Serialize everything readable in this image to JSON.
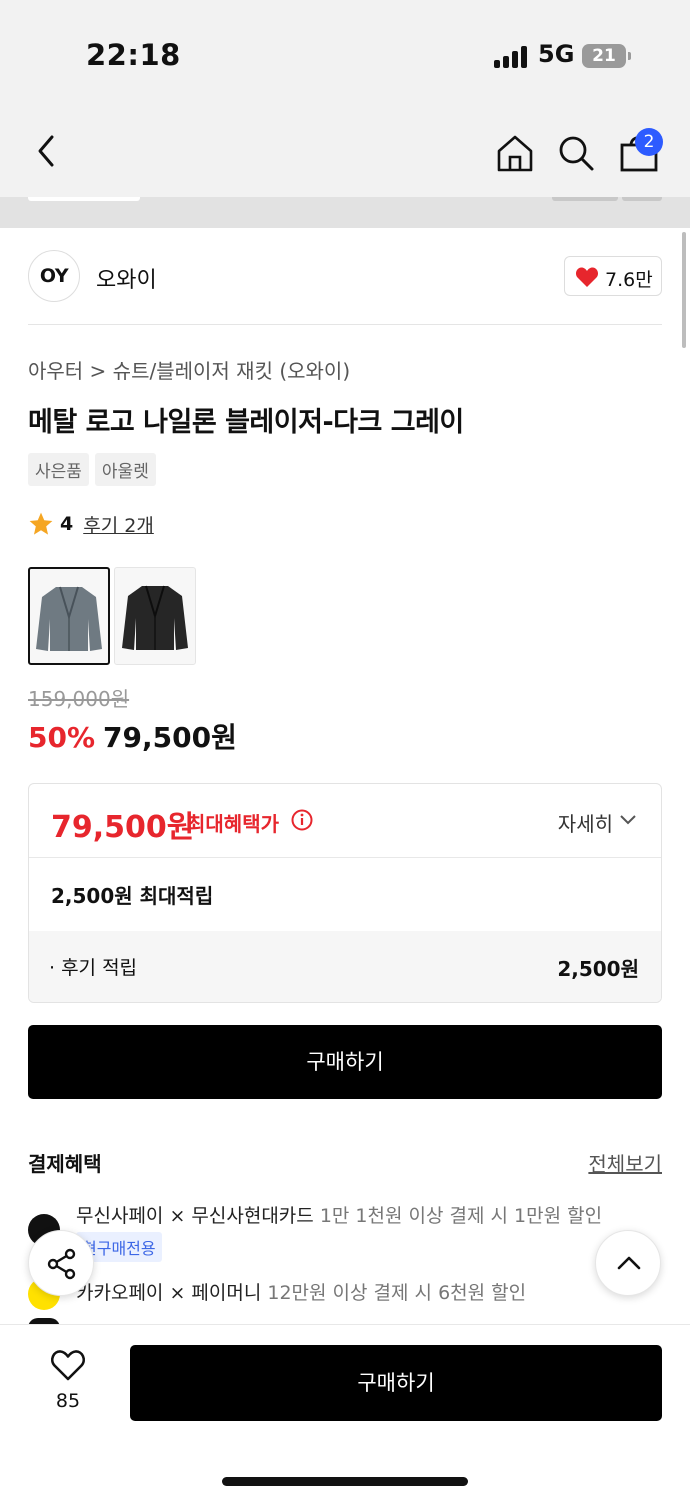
{
  "status_bar": {
    "time": "22:18",
    "network": "5G",
    "battery": "21"
  },
  "nav": {
    "cart_count": "2"
  },
  "brand": {
    "logo_text": "OY",
    "name": "오와이",
    "likes": "7.6만"
  },
  "product": {
    "breadcrumb": "아우터 > 슈트/블레이저 재킷 (오와이)",
    "title": "메탈 로고 나일론 블레이저-다크 그레이",
    "tags": [
      "사은품",
      "아울렛"
    ],
    "rating": "4",
    "review_link": "후기 2개",
    "thumbnail_colors": [
      "dark gray",
      "black"
    ],
    "original_price": "159,000원",
    "discount": "50%",
    "sale_price": "79,500원"
  },
  "benefit": {
    "max_price": "79,500원",
    "max_label": "최대혜택가",
    "detail_label": "자세히",
    "points_label": "2,500원 최대적립",
    "review_points_label": "· 후기 적립",
    "review_points_value": "2,500원"
  },
  "buttons": {
    "buy": "구매하기",
    "bottom_buy": "구매하기"
  },
  "payment": {
    "title": "결제혜택",
    "see_all": "전체보기",
    "line1_main": "무신사페이 × 무신사현대카드",
    "line1_sub": "1만 1천원 이상 결제 시 1만원 할인",
    "line1_chip": "현구매전용",
    "line2_main": "카카오페이 × 페이머니",
    "line2_sub": "12만원 이상 결제 시 6천원 할인"
  },
  "bottom": {
    "wish_count": "85"
  },
  "colors": {
    "accent_red": "#e7262d",
    "badge_blue": "#2d5bff",
    "black": "#000000"
  }
}
